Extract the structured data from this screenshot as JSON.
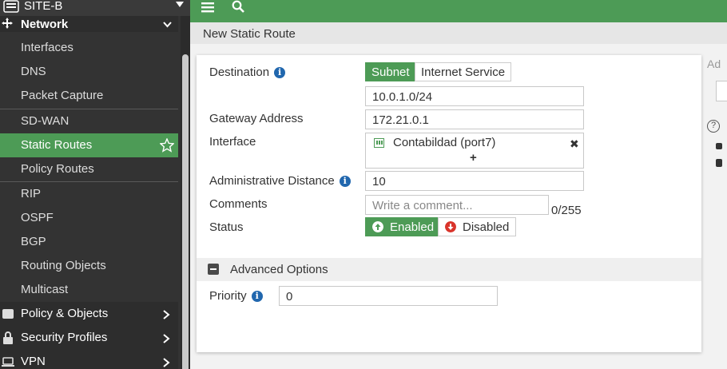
{
  "sidebar": {
    "device_name": "SITE-B",
    "section": "Network",
    "items": [
      {
        "label": "Interfaces"
      },
      {
        "label": "DNS"
      },
      {
        "label": "Packet Capture"
      },
      {
        "label": "SD-WAN"
      },
      {
        "label": "Static Routes"
      },
      {
        "label": "Policy Routes"
      },
      {
        "label": "RIP"
      },
      {
        "label": "OSPF"
      },
      {
        "label": "BGP"
      },
      {
        "label": "Routing Objects"
      },
      {
        "label": "Multicast"
      }
    ],
    "groups": [
      {
        "label": "Policy & Objects",
        "icon": "policy-icon"
      },
      {
        "label": "Security Profiles",
        "icon": "lock-icon"
      },
      {
        "label": "VPN",
        "icon": "laptop-icon"
      }
    ]
  },
  "page": {
    "title": "New Static Route"
  },
  "form": {
    "destination_label": "Destination",
    "dest_type_subnet": "Subnet",
    "dest_type_internet": "Internet Service",
    "destination_value": "10.0.1.0/24",
    "gateway_label": "Gateway Address",
    "gateway_value": "172.21.0.1",
    "interface_label": "Interface",
    "interface_value": "Contabildad (port7)",
    "admin_distance_label": "Administrative Distance",
    "admin_distance_value": "10",
    "comments_label": "Comments",
    "comments_placeholder": "Write a comment...",
    "comments_counter": "0/255",
    "status_label": "Status",
    "status_enabled": "Enabled",
    "status_disabled": "Disabled",
    "advanced_label": "Advanced Options",
    "priority_label": "Priority",
    "priority_value": "0"
  },
  "right_edge": {
    "partial_text": "Ad"
  },
  "colors": {
    "accent": "#4d9b56",
    "sidebar_bg": "#333333",
    "info_blue": "#2167ae",
    "disabled_red": "#d9342b"
  }
}
